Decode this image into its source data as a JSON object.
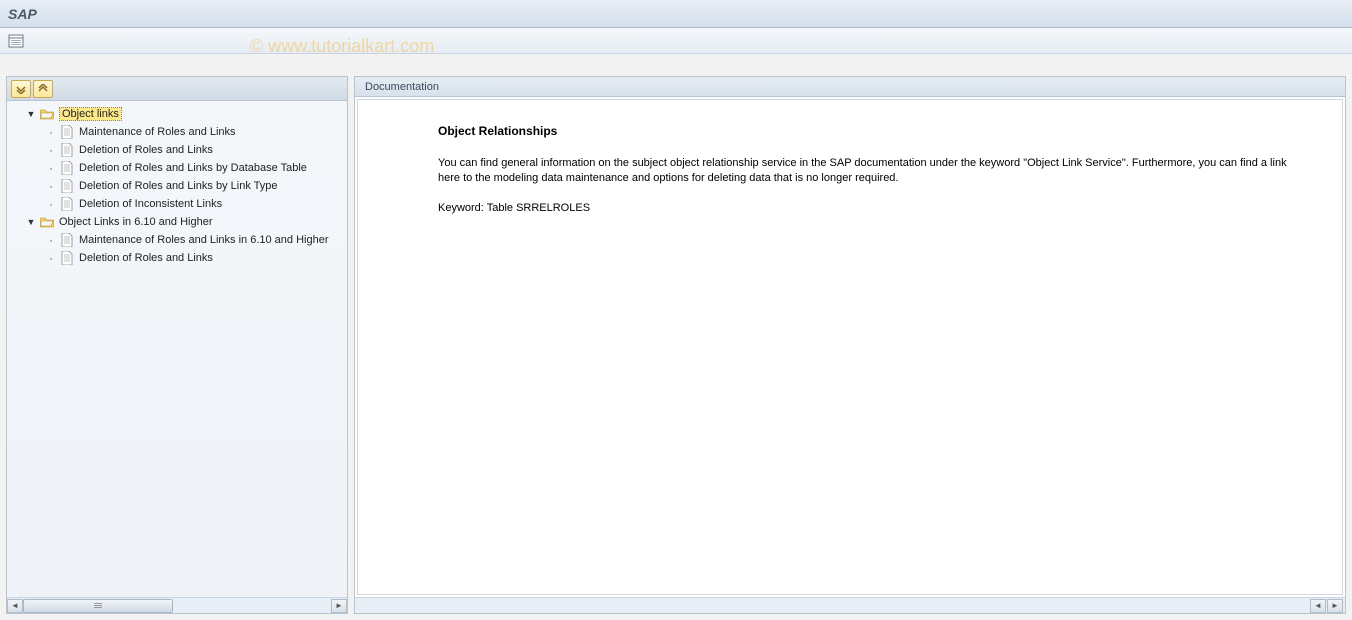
{
  "header": {
    "title": "SAP"
  },
  "watermark": "© www.tutorialkart.com",
  "tree": {
    "groups": [
      {
        "label": "Object links",
        "selected": true,
        "items": [
          {
            "label": "Maintenance of Roles and Links"
          },
          {
            "label": "Deletion of Roles and Links"
          },
          {
            "label": "Deletion of Roles and Links by Database Table"
          },
          {
            "label": "Deletion of Roles and Links by Link Type"
          },
          {
            "label": "Deletion of Inconsistent Links"
          }
        ]
      },
      {
        "label": "Object Links in 6.10 and Higher",
        "selected": false,
        "items": [
          {
            "label": "Maintenance of Roles and Links in 6.10 and Higher"
          },
          {
            "label": "Deletion of Roles and Links"
          }
        ]
      }
    ]
  },
  "documentation": {
    "panel_title": "Documentation",
    "title": "Object Relationships",
    "para1": "You can find general information on the subject object relationship service in the SAP documentation under the keyword \"Object Link Service\". Furthermore, you can find a link here to the modeling data maintenance and options for deleting data that is no longer required.",
    "para2": "Keyword: Table SRRELROLES"
  }
}
